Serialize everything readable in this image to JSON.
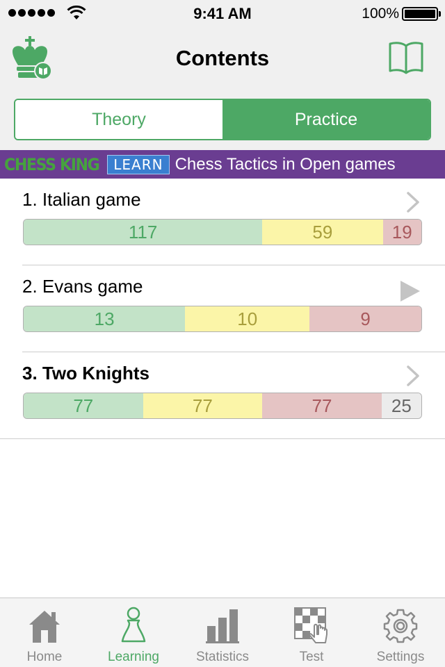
{
  "status_bar": {
    "time": "9:41 AM",
    "battery": "100%"
  },
  "nav": {
    "title": "Contents",
    "left_icon": "chess-king-logo-icon",
    "right_icon": "book-icon"
  },
  "segments": {
    "theory": "Theory",
    "practice": "Practice",
    "selected": "Practice"
  },
  "banner": {
    "brand": "CHESS KING",
    "badge": "LEARN",
    "text": "Chess Tactics in Open games"
  },
  "items": [
    {
      "title": "1. Italian game",
      "indicator": "chevron-right-icon",
      "progress": {
        "green": "117",
        "yellow": "59",
        "red": "19"
      }
    },
    {
      "title": "2. Evans game",
      "indicator": "play-icon",
      "progress": {
        "green": "13",
        "yellow": "10",
        "red": "9"
      }
    },
    {
      "title": "3. Two Knights",
      "indicator": "chevron-right-icon",
      "progress": {
        "green": "77",
        "yellow": "77",
        "red": "77",
        "grey": "25"
      }
    }
  ],
  "tabs": [
    {
      "label": "Home",
      "icon": "home-icon"
    },
    {
      "label": "Learning",
      "icon": "pawn-icon"
    },
    {
      "label": "Statistics",
      "icon": "bar-chart-icon"
    },
    {
      "label": "Test",
      "icon": "chessboard-hand-icon"
    },
    {
      "label": "Settings",
      "icon": "gear-icon"
    }
  ],
  "active_tab": "Learning",
  "colors": {
    "accent_green": "#4da865",
    "banner_purple": "#6a3d91",
    "learn_blue": "#3a7fd0"
  }
}
